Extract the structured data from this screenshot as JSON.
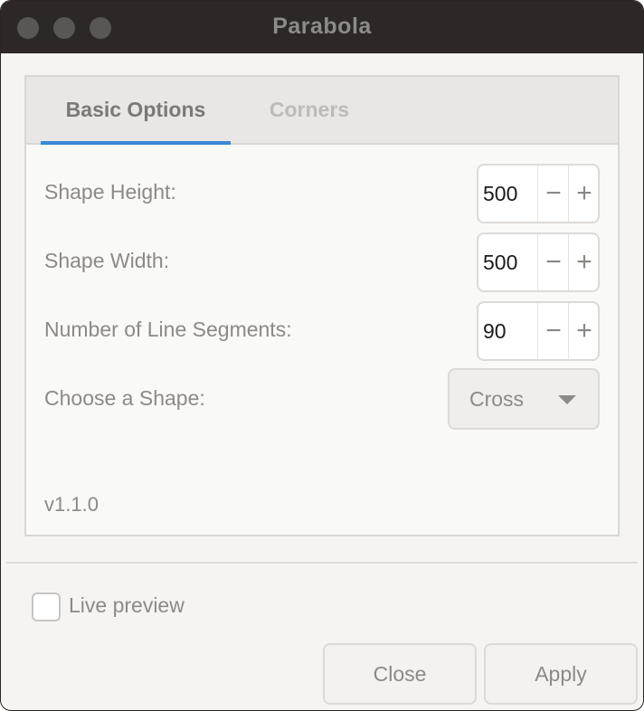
{
  "window": {
    "title": "Parabola"
  },
  "tabs": [
    {
      "label": "Basic Options",
      "active": true
    },
    {
      "label": "Corners",
      "active": false
    }
  ],
  "fields": {
    "shape_height": {
      "label": "Shape Height:",
      "value": "500"
    },
    "shape_width": {
      "label": "Shape Width:",
      "value": "500"
    },
    "line_segments": {
      "label": "Number of Line Segments:",
      "value": "90"
    },
    "shape": {
      "label": "Choose a Shape:",
      "selected": "Cross"
    }
  },
  "stepper_glyphs": {
    "minus": "−",
    "plus": "+"
  },
  "version": "v1.1.0",
  "live_preview": {
    "label": "Live preview",
    "checked": false
  },
  "buttons": {
    "close": "Close",
    "apply": "Apply"
  },
  "colors": {
    "accent": "#3a87d8",
    "titlebar": "#2d2727"
  }
}
